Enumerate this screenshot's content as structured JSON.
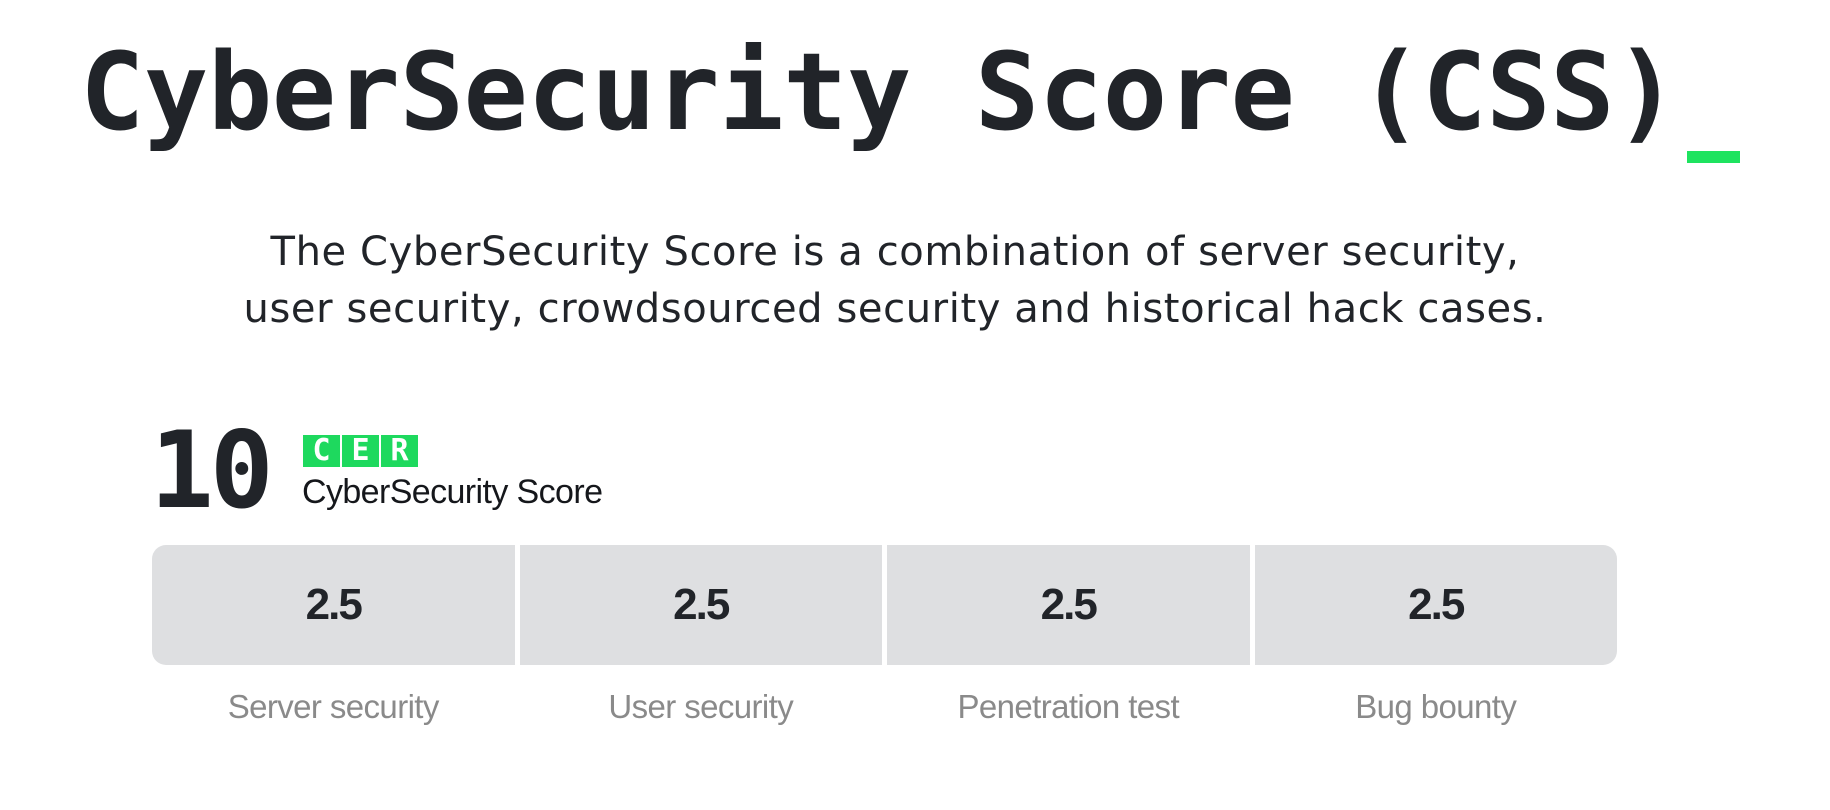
{
  "header": {
    "title": "CyberSecurity Score (CSS)",
    "cursor_color": "#1ee35f"
  },
  "description": {
    "line1": "The CyberSecurity Score is a combination of server security,",
    "line2": "user security, crowdsourced security and historical hack cases."
  },
  "score": {
    "value": "10",
    "logo_letters": [
      "C",
      "E",
      "R"
    ],
    "logo_color": "#1ed95e",
    "label": "CyberSecurity Score"
  },
  "metrics": [
    {
      "value": "2.5",
      "label": "Server security"
    },
    {
      "value": "2.5",
      "label": "User security"
    },
    {
      "value": "2.5",
      "label": "Penetration test"
    },
    {
      "value": "2.5",
      "label": "Bug bounty"
    }
  ]
}
